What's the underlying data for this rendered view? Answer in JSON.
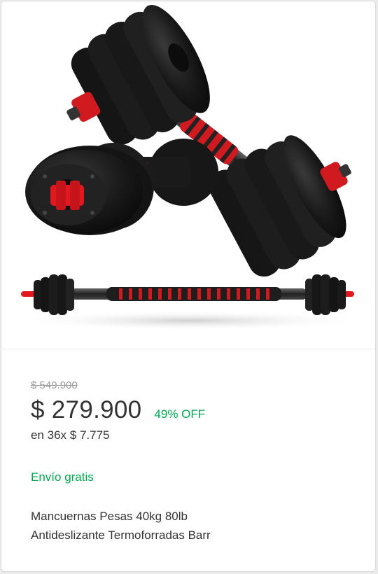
{
  "product": {
    "image_alt": "dumbbell-product-photo",
    "original_price": "$ 549.900",
    "price": "$ 279.900",
    "discount": "49% OFF",
    "installments": "en 36x $ 7.775",
    "shipping": "Envío gratis",
    "title_line1": "Mancuernas Pesas 40kg 80lb",
    "title_line2": "Antideslizante Termoforradas Barr"
  },
  "colors": {
    "accent_green": "#00a650",
    "text": "#333333",
    "muted": "#999999",
    "plate": "#1b1b1b",
    "red": "#e3171e"
  }
}
